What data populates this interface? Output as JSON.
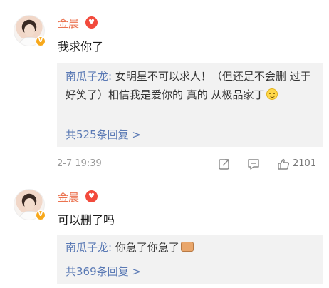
{
  "comments": [
    {
      "username": "金晨",
      "text": "我求你了",
      "reply": {
        "author": "南瓜子龙:",
        "body": " 女明星不可以求人！（但还是不会删 过于好笑了）相信我是爱你的 真的 从极品家丁",
        "more": "共525条回复 >"
      },
      "meta": {
        "timestamp": "2-7 19:39",
        "likes": "2101"
      }
    },
    {
      "username": "金晨",
      "text": "可以删了吗",
      "reply": {
        "author": "南瓜子龙:",
        "body": " 你急了你急了",
        "more": "共369条回复 >"
      }
    }
  ],
  "icons": {
    "verified": "v-badge",
    "fan": "fan-badge-icon",
    "share": "share-icon",
    "comment": "comment-icon",
    "like": "like-icon"
  },
  "colors": {
    "username": "#eb7350",
    "link": "#5b7ab5",
    "reply_bg": "#f2f2f2",
    "verified": "#f7a81b"
  }
}
